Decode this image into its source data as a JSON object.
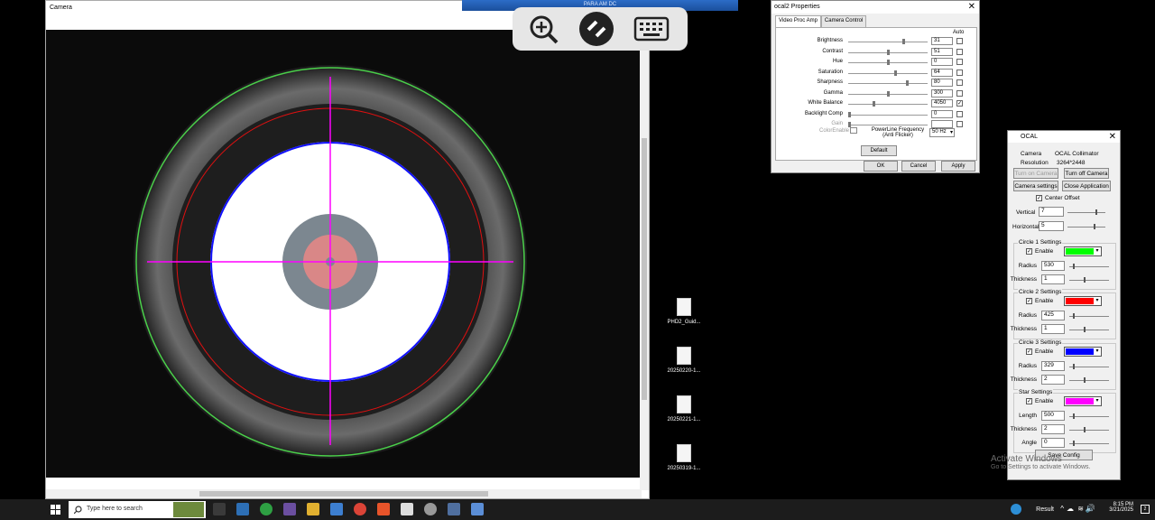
{
  "camera_window": {
    "title": "Camera"
  },
  "remote_bar": {
    "title": "PARA AM DC"
  },
  "properties": {
    "title": "ocal2 Properties",
    "tabs": [
      "Video Proc Amp",
      "Camera Control"
    ],
    "auto_header": "Auto",
    "rows": [
      {
        "label": "Brightness",
        "value": "31",
        "level": 0.7,
        "auto": false,
        "disabled": false
      },
      {
        "label": "Contrast",
        "value": "51",
        "level": 0.5,
        "auto": false,
        "disabled": false
      },
      {
        "label": "Hue",
        "value": "0",
        "level": 0.5,
        "auto": false,
        "disabled": false
      },
      {
        "label": "Saturation",
        "value": "64",
        "level": 0.6,
        "auto": false,
        "disabled": false
      },
      {
        "label": "Sharpness",
        "value": "80",
        "level": 0.75,
        "auto": false,
        "disabled": false
      },
      {
        "label": "Gamma",
        "value": "300",
        "level": 0.5,
        "auto": false,
        "disabled": false
      },
      {
        "label": "White Balance",
        "value": "4050",
        "level": 0.32,
        "auto": true,
        "disabled": false
      },
      {
        "label": "Backlight Comp",
        "value": "0",
        "level": 0.0,
        "auto": false,
        "disabled": false
      },
      {
        "label": "Gain",
        "value": "",
        "level": 0.0,
        "auto": false,
        "disabled": true
      }
    ],
    "color_enable_label": "ColorEnable",
    "powerline_label": "PowerLine Frequency",
    "powerline_sub": "(Anti Flicker)",
    "powerline_value": "50 Hz",
    "default_label": "Default",
    "ok_label": "OK",
    "cancel_label": "Cancel",
    "apply_label": "Apply"
  },
  "ocal": {
    "title": "OCAL",
    "camera_label": "Camera",
    "camera_value": "OCAL Collimator",
    "resolution_label": "Resolution",
    "resolution_value": "3264*2448",
    "turn_on": "Turn on Camera",
    "turn_off": "Turn off Camera",
    "camera_settings": "Camera settings",
    "close_app": "Close Application",
    "center_offset": "Center Offset",
    "vertical_label": "Vertical",
    "vertical_value": "7",
    "horizontal_label": "Horizontal",
    "horizontal_value": "5",
    "circle1": {
      "title": "Circle 1 Settings",
      "enable": "Enable",
      "color": "#00ff00",
      "radius_label": "Radius",
      "radius": "530",
      "thickness_label": "Thickness",
      "thickness": "1"
    },
    "circle2": {
      "title": "Circle 2 Settings",
      "enable": "Enable",
      "color": "#ff0000",
      "radius_label": "Radius",
      "radius": "425",
      "thickness_label": "Thickness",
      "thickness": "1"
    },
    "circle3": {
      "title": "Circle 3 Settings",
      "enable": "Enable",
      "color": "#0000ff",
      "radius_label": "Radius",
      "radius": "329",
      "thickness_label": "Thickness",
      "thickness": "2"
    },
    "star": {
      "title": "Star Settings",
      "enable": "Enable",
      "color": "#ff00ff",
      "length_label": "Length",
      "length": "500",
      "thickness_label": "Thickness",
      "thickness": "2",
      "angle_label": "Angle",
      "angle": "0"
    },
    "save_config": "Save Config"
  },
  "desktop_icons": [
    "PHD2_Guid...",
    "20250220-1...",
    "20250221-1...",
    "20250319-1..."
  ],
  "watermark": {
    "line1": "Activate Windows",
    "line2": "Go to Settings to activate Windows."
  },
  "taskbar": {
    "search_placeholder": "Type here to search",
    "result_label": "Result",
    "time": "8:15 PM",
    "date": "3/21/2025",
    "notification_count": "2"
  }
}
